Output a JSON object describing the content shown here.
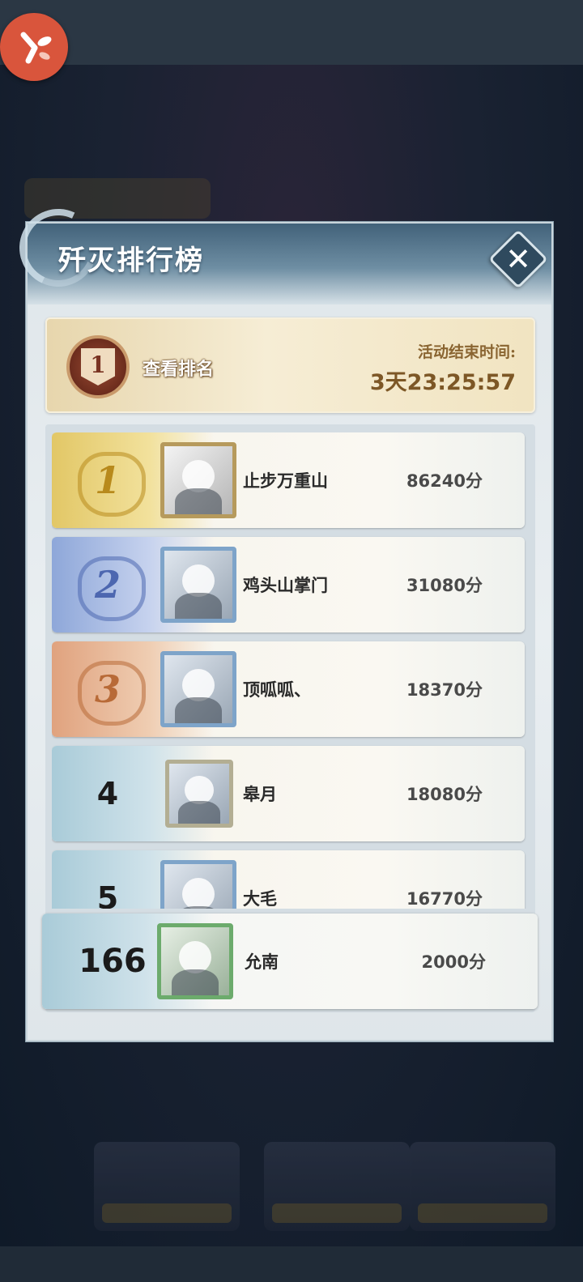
{
  "overlay": {
    "title": "歼灭排行榜",
    "close_glyph": "✕"
  },
  "banner": {
    "emblem_number": "1",
    "view_rank_label": "查看排名",
    "end_time_label": "活动结束时间:",
    "end_time_value": "3天23:25:57"
  },
  "ranking": [
    {
      "rank": "1",
      "name": "止步万重山",
      "score": "86240分",
      "tier": "gold"
    },
    {
      "rank": "2",
      "name": "鸡头山掌门",
      "score": "31080分",
      "tier": "blue"
    },
    {
      "rank": "3",
      "name": "顶呱呱、",
      "score": "18370分",
      "tier": "copper"
    },
    {
      "rank": "4",
      "name": "皋月",
      "score": "18080分",
      "tier": "plain"
    },
    {
      "rank": "5",
      "name": "大毛",
      "score": "16770分",
      "tier": "plain"
    }
  ],
  "self_entry": {
    "rank": "166",
    "name": "允南",
    "score": "2000分"
  },
  "colors": {
    "gold": "#e2c766",
    "blue": "#8ea7d9",
    "copper": "#e0a27e",
    "plain": "#a9cbd8",
    "app_logo": "#d9553c"
  }
}
